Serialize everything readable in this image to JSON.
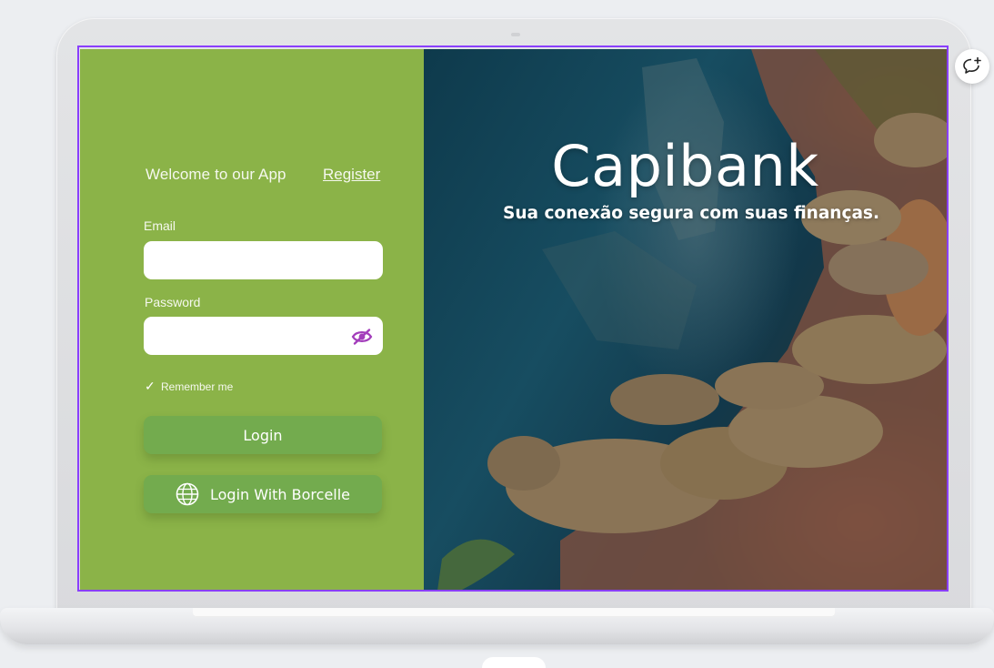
{
  "colors": {
    "panel_green": "#8bb348",
    "button_green": "#73ab4e",
    "eye_icon_purple": "#a33dbb",
    "selection_purple": "#8a3ffc"
  },
  "login": {
    "welcome_text": "Welcome to our App",
    "register_link": "Register",
    "email_label": "Email",
    "email_value": "",
    "password_label": "Password",
    "password_value": "",
    "password_icon": "eye-off-icon",
    "remember_checked": true,
    "remember_check_glyph": "✓",
    "remember_label": "Remember me",
    "login_button": "Login",
    "sso_icon": "globe-icon",
    "sso_button": "Login With Borcelle"
  },
  "hero": {
    "title": "Capibank",
    "subtitle": "Sua conexão segura com suas finanças."
  },
  "toolbar": {
    "comment_icon": "add-comment-icon"
  }
}
